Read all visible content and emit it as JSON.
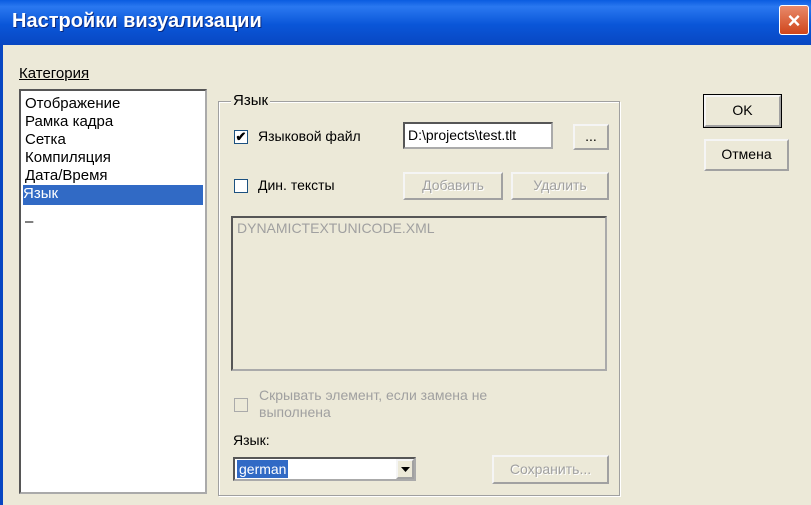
{
  "window": {
    "title": "Настройки визуализации",
    "close_glyph": "×"
  },
  "category": {
    "label": "Категория",
    "items": [
      "Отображение",
      "Рамка кадра",
      "Сетка",
      "Компиляция",
      "Дата/Время",
      "Язык",
      "–"
    ],
    "selected": "Язык"
  },
  "language_group": {
    "title": "Язык",
    "language_file": {
      "label": "Языковой файл",
      "checked": true,
      "value": "D:\\projects\\test.tlt",
      "browse_label": "..."
    },
    "dyn_texts": {
      "label": "Дин. тексты",
      "checked": false,
      "add_label": "Добавить",
      "delete_label": "Удалить"
    },
    "dyn_file_list": [
      "DYNAMICTEXTUNICODE.XML"
    ],
    "hide_element": {
      "label_line1": "Скрывать элемент, если замена не",
      "label_line2": "выполнена",
      "checked": false,
      "enabled": false
    },
    "language_label": "Язык:",
    "language_value": "german",
    "save_label": "Сохранить..."
  },
  "buttons": {
    "ok": "OK",
    "cancel": "Отмена"
  },
  "colors": {
    "titlebar": "#0a56d8",
    "selection": "#316ac5",
    "dialog_bg": "#ece9d8"
  }
}
